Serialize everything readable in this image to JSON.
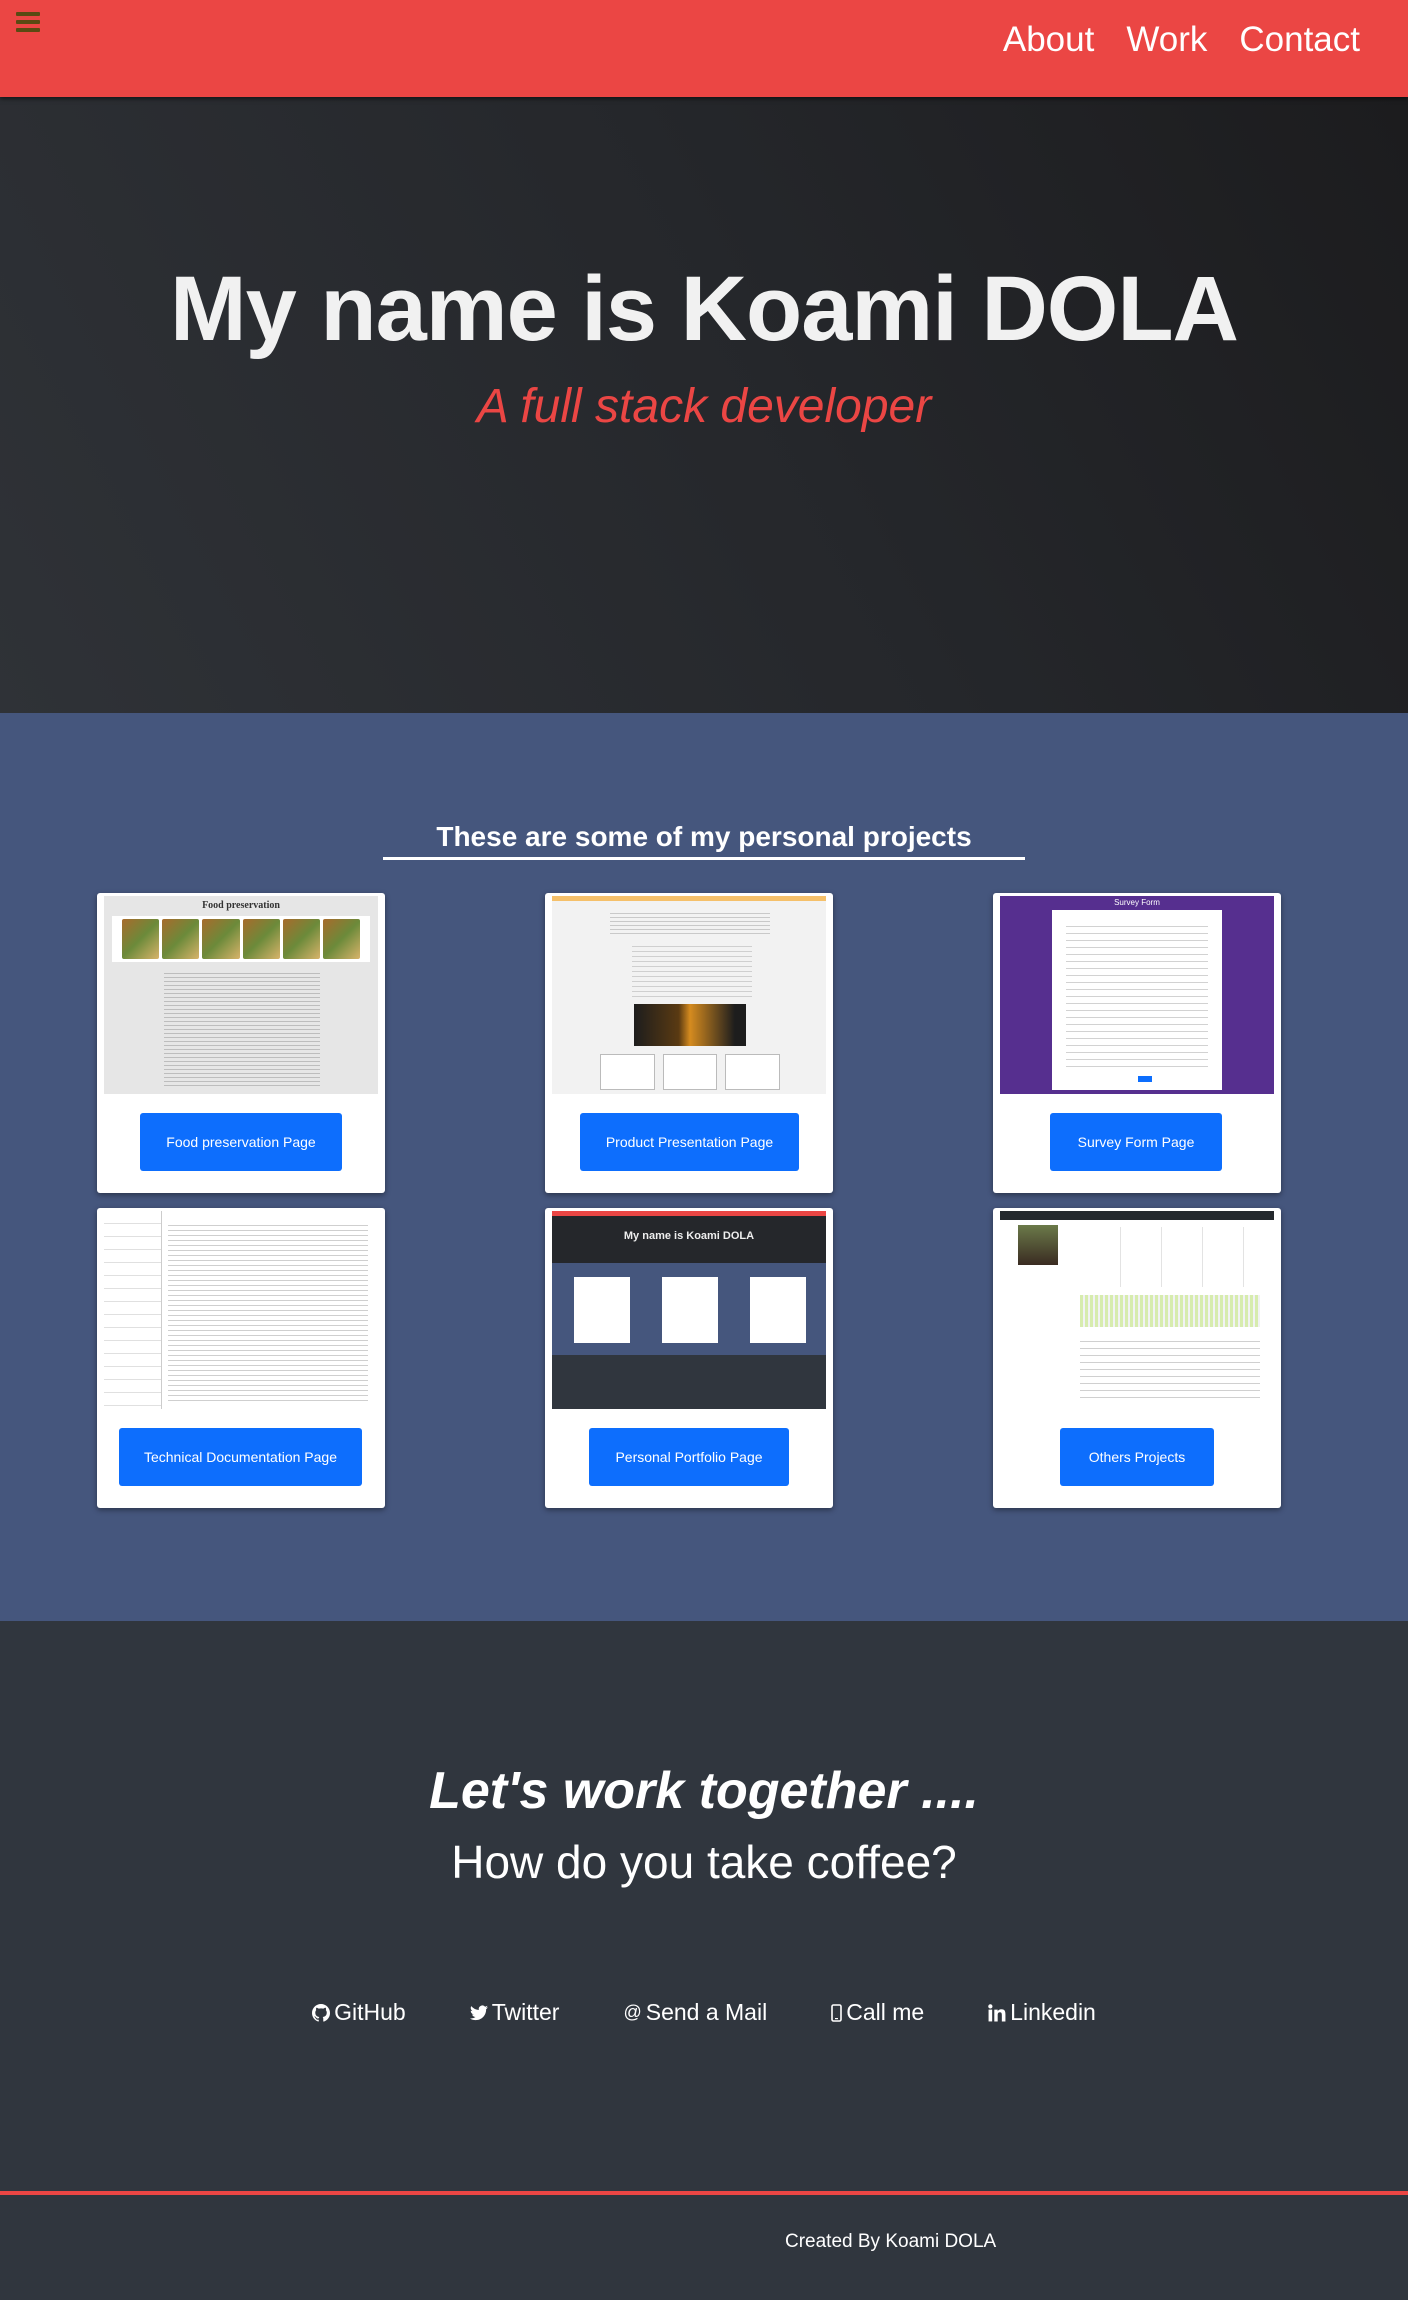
{
  "nav": {
    "links": [
      "About",
      "Work",
      "Contact"
    ],
    "menu_icon": "hamburger-icon",
    "bg_color": "#eb4644"
  },
  "hero": {
    "title": "My name is Koami DOLA",
    "subtitle": "A full stack developer",
    "subtitle_color": "#eb4644"
  },
  "projects": {
    "heading": "These are some of my personal projects",
    "bg_color": "#45567d",
    "items": [
      {
        "label": "Food preservation Page",
        "thumb_title": "Food preservation"
      },
      {
        "label": "Product Presentation Page"
      },
      {
        "label": "Survey Form Page",
        "thumb_title": "Survey Form"
      },
      {
        "label": "Technical Documentation Page"
      },
      {
        "label": "Personal Portfolio Page",
        "thumb_title": "My name is Koami DOLA"
      },
      {
        "label": "Others Projects"
      }
    ]
  },
  "contact": {
    "title": "Let's work together ....",
    "subtitle": "How do you take coffee?",
    "links": [
      {
        "label": "GitHub",
        "icon": "github-icon"
      },
      {
        "label": "Twitter",
        "icon": "twitter-icon"
      },
      {
        "label": "Send a Mail",
        "icon": "at-icon"
      },
      {
        "label": "Call me",
        "icon": "phone-icon"
      },
      {
        "label": "Linkedin",
        "icon": "linkedin-icon"
      }
    ]
  },
  "footer": {
    "text": "Created By Koami DOLA"
  },
  "button_color": "#0d6efd"
}
